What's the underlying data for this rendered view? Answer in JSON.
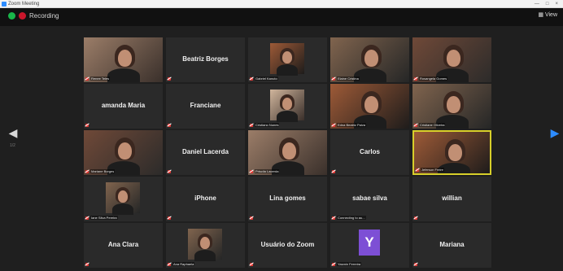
{
  "window": {
    "title": "Zoom Meeting",
    "controls": [
      "—",
      "□",
      "×"
    ]
  },
  "top_bar": {
    "status_text": "Recording",
    "view_label": "View"
  },
  "navigation": {
    "left_page": "1/2"
  },
  "participants": [
    {
      "display": "",
      "label": "Renee Teles",
      "video": true,
      "active": false
    },
    {
      "display": "Beatriz Borges",
      "label": "",
      "video": false,
      "active": false
    },
    {
      "display": "",
      "label": "Gabriel Kanuto",
      "video": true,
      "active": false,
      "small": true
    },
    {
      "display": "",
      "label": "Elaine Cristina",
      "video": true,
      "active": false
    },
    {
      "display": "",
      "label": "Rosangela Gomes",
      "video": true,
      "active": false
    },
    {
      "display": "amanda Maria",
      "label": "",
      "video": false,
      "active": false
    },
    {
      "display": "Franciane",
      "label": "",
      "video": false,
      "active": false
    },
    {
      "display": "",
      "label": "Cristiano Nunes",
      "video": true,
      "active": false,
      "small": true
    },
    {
      "display": "",
      "label": "Edna Beatriz Paiva",
      "video": true,
      "active": false
    },
    {
      "display": "",
      "label": "Cristiane Oliveira",
      "video": true,
      "active": false
    },
    {
      "display": "",
      "label": "Mariane Borges",
      "video": true,
      "active": false
    },
    {
      "display": "Daniel Lacerda",
      "label": "",
      "video": false,
      "active": false
    },
    {
      "display": "",
      "label": "Priscila Lacerda",
      "video": true,
      "active": false
    },
    {
      "display": "Carlos",
      "label": "",
      "video": false,
      "active": false
    },
    {
      "display": "",
      "label": "Jeferson Freire",
      "video": true,
      "active": true
    },
    {
      "display": "",
      "label": "Iane Silva Pereira",
      "video": true,
      "active": false,
      "small": true
    },
    {
      "display": "iPhone",
      "label": "",
      "video": false,
      "active": false
    },
    {
      "display": "Lina gomes",
      "label": "",
      "video": false,
      "active": false
    },
    {
      "display": "sabae silva",
      "label": "Connecting to au...",
      "video": false,
      "active": false
    },
    {
      "display": "willian",
      "label": "",
      "video": false,
      "active": false
    },
    {
      "display": "Ana Clara",
      "label": "",
      "video": false,
      "active": false
    },
    {
      "display": "",
      "label": "Ana Raphaela",
      "video": true,
      "active": false,
      "small": true
    },
    {
      "display": "Usuário do Zoom",
      "label": "",
      "video": false,
      "active": false
    },
    {
      "display": "",
      "label": "Yasmin Ferreira",
      "video": false,
      "active": false,
      "avatar": "Y"
    },
    {
      "display": "Mariana",
      "label": "",
      "video": false,
      "active": false
    }
  ]
}
